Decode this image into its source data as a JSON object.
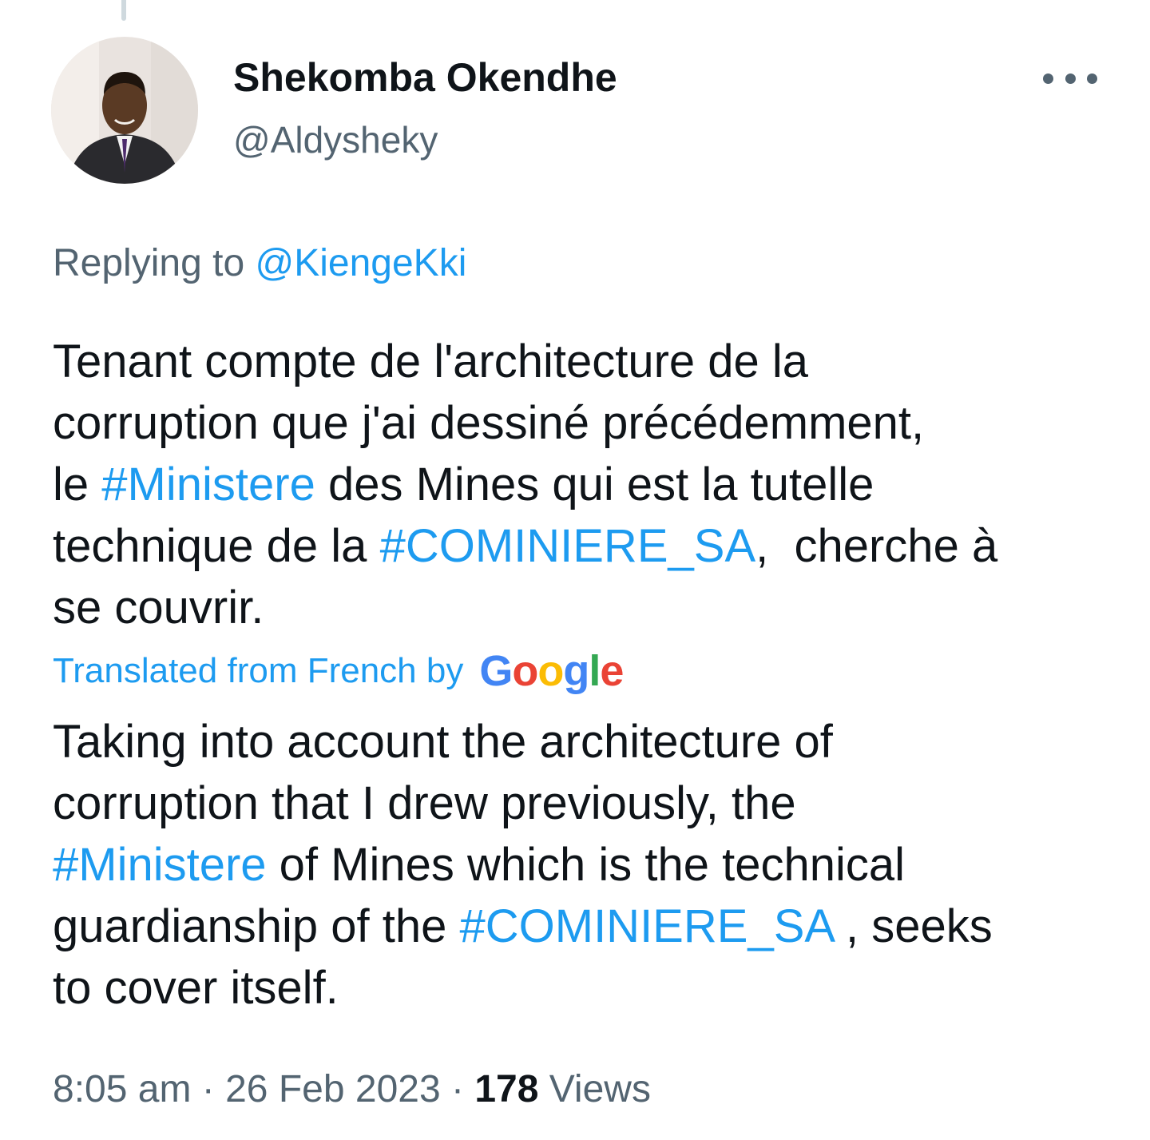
{
  "author": {
    "display_name": "Shekomba Okendhe",
    "handle": "@Aldysheky",
    "avatar_icon": "profile-photo"
  },
  "more_icon": "more-horizontal-icon",
  "reply": {
    "prefix": "Replying to",
    "mention": "@KiengeKki"
  },
  "tweet": {
    "line1": "Tenant compte de l'architecture de la",
    "line2": "corruption que j'ai dessiné précédemment,",
    "line3_a": "le",
    "line3_hashtag": "#Ministere",
    "line3_b": "des Mines qui est la tutelle",
    "line4_a": "technique de la",
    "line4_hashtag": "#COMINIERE_SA",
    "line4_b": ",  cherche à",
    "line5": "se couvrir."
  },
  "translation": {
    "label": "Translated from French by",
    "provider_letters": [
      "G",
      "o",
      "o",
      "g",
      "l",
      "e"
    ],
    "line1": "Taking into account the architecture of",
    "line2": "corruption that I drew previously, the",
    "line3_hashtag": "#Ministere",
    "line3_b": "of Mines which is the technical",
    "line4_a": "guardianship of the",
    "line4_hashtag": "#COMINIERE_SA",
    "line4_b": ", seeks",
    "line5": "to cover itself."
  },
  "meta": {
    "time": "8:05 am",
    "separator": "·",
    "date": "26 Feb 2023",
    "views_count": "178",
    "views_label": "Views"
  },
  "colors": {
    "link": "#1d9bf0",
    "text": "#0f1419",
    "secondary": "#536471",
    "google_blue": "#4285f4",
    "google_red": "#ea4335",
    "google_yellow": "#fbbc05",
    "google_green": "#34a853"
  }
}
